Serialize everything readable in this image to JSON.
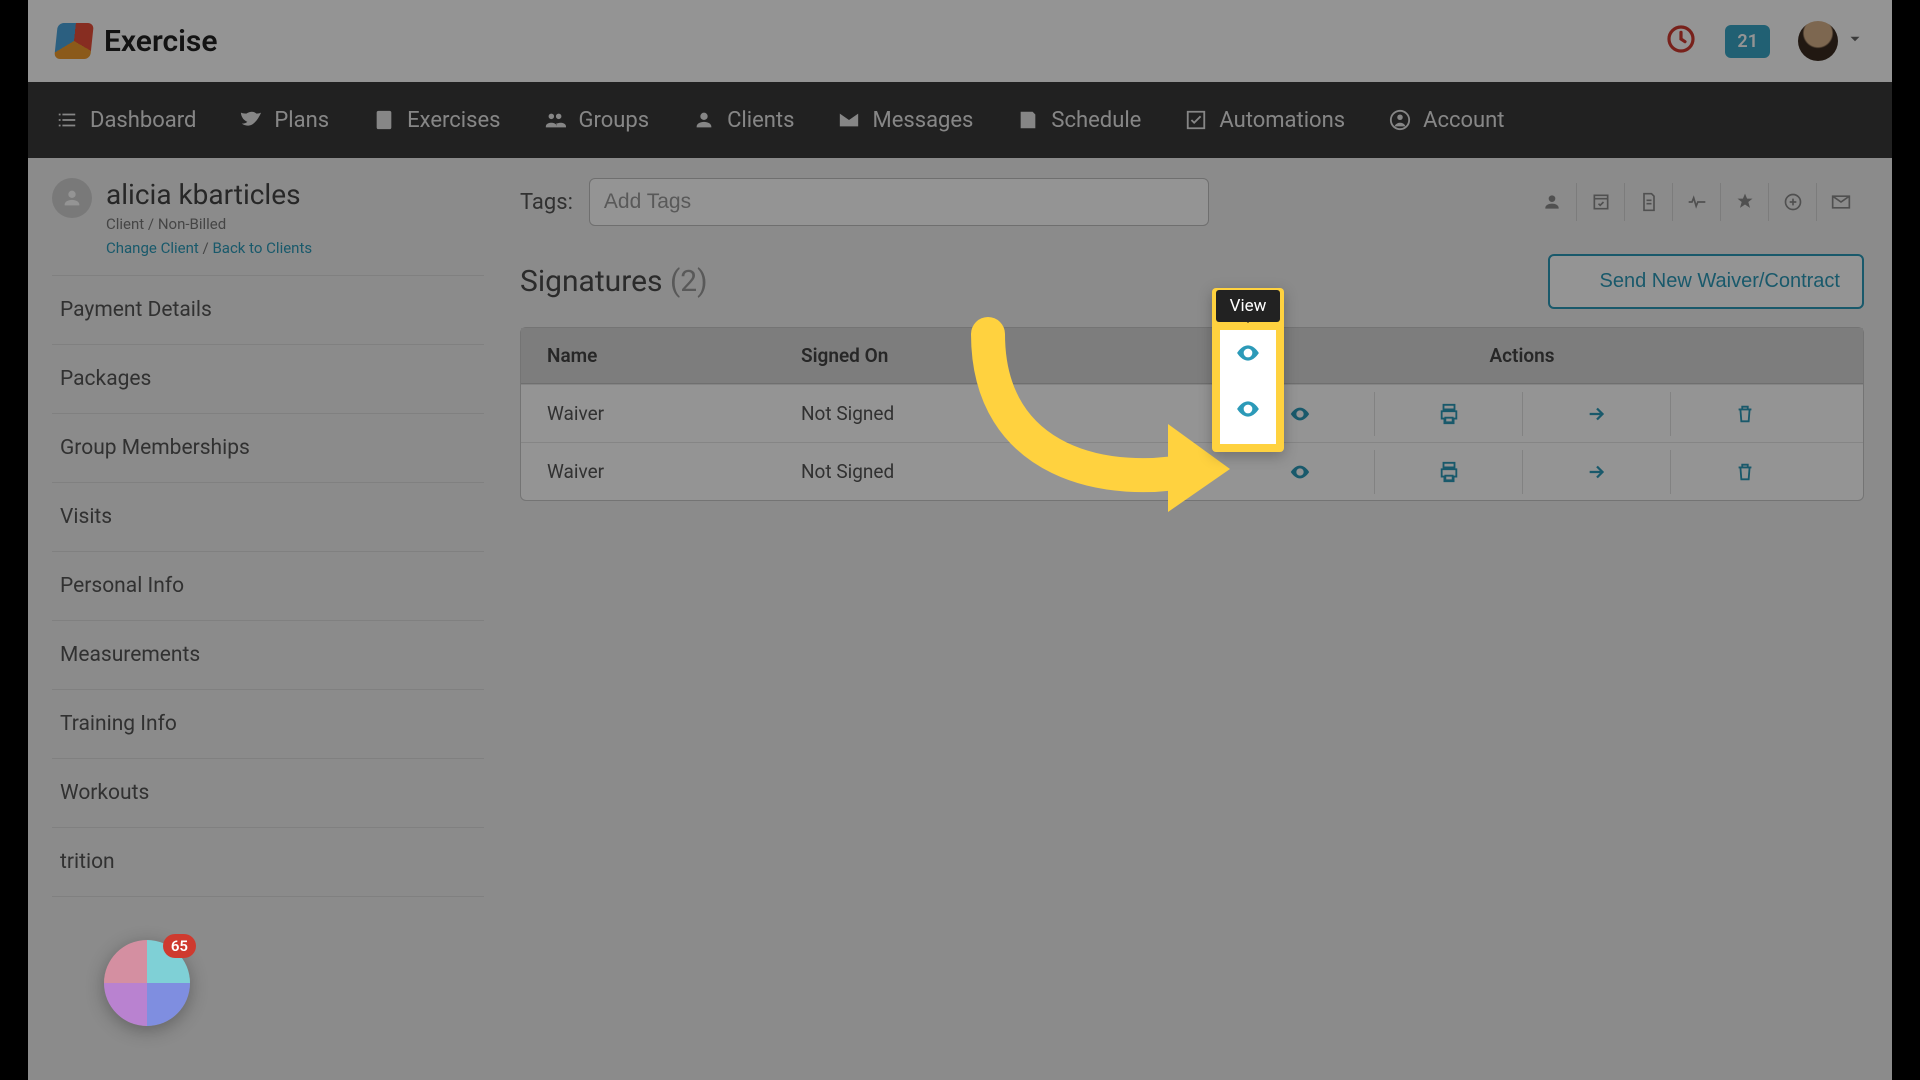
{
  "brand": {
    "name": "Exercise"
  },
  "header": {
    "notif_count": "21"
  },
  "nav": [
    {
      "label": "Dashboard",
      "icon": "list-icon"
    },
    {
      "label": "Plans",
      "icon": "bird-icon"
    },
    {
      "label": "Exercises",
      "icon": "phone-icon"
    },
    {
      "label": "Groups",
      "icon": "users-icon"
    },
    {
      "label": "Clients",
      "icon": "user-icon"
    },
    {
      "label": "Messages",
      "icon": "mail-icon"
    },
    {
      "label": "Schedule",
      "icon": "book-icon"
    },
    {
      "label": "Automations",
      "icon": "check-icon"
    },
    {
      "label": "Account",
      "icon": "person-circle-icon"
    }
  ],
  "client": {
    "name": "alicia kbarticles",
    "subtitle": "Client / Non-Billed",
    "change_link": "Change Client",
    "separator": "/",
    "back_link": "Back to Clients"
  },
  "sidebar": {
    "items": [
      "Payment Details",
      "Packages",
      "Group Memberships",
      "Visits",
      "Personal Info",
      "Measurements",
      "Training Info",
      "Workouts",
      "trition"
    ]
  },
  "tags": {
    "label": "Tags:",
    "placeholder": "Add Tags"
  },
  "signatures": {
    "title": "Signatures",
    "count": "(2)",
    "send_label": "Send New Waiver/Contract",
    "columns": {
      "name": "Name",
      "signed_on": "Signed On",
      "actions": "Actions"
    },
    "rows": [
      {
        "name": "Waiver",
        "signed_on": "Not Signed"
      },
      {
        "name": "Waiver",
        "signed_on": "Not Signed"
      }
    ]
  },
  "tooltip": {
    "view": "View"
  },
  "float": {
    "count": "65"
  }
}
